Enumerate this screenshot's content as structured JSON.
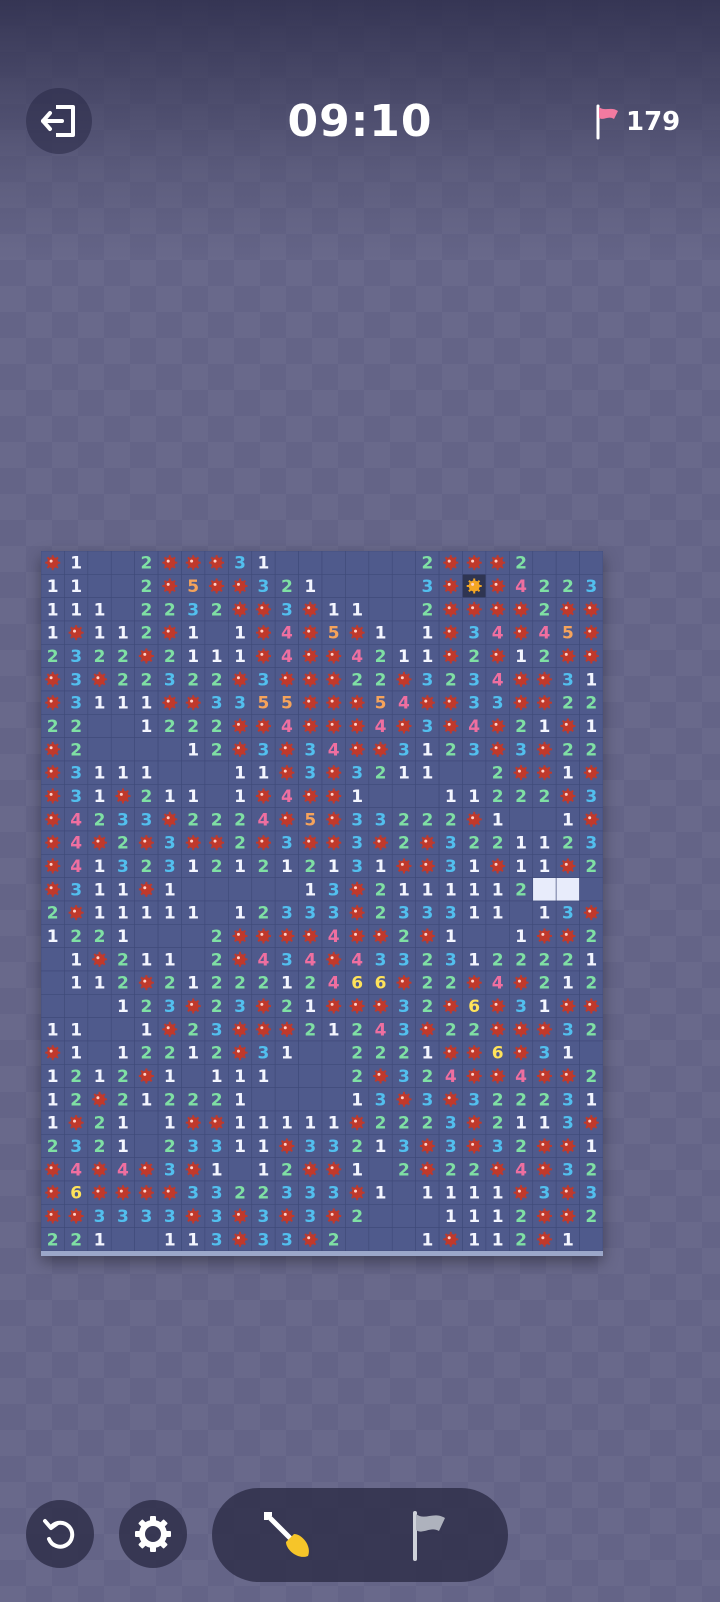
{
  "header": {
    "timer": "09:10",
    "flags_remaining": "179",
    "exit_icon": "exit-icon",
    "flag_icon": "flag-icon"
  },
  "board": {
    "cols": 24,
    "rows": 30,
    "grid": [
      "M1..2MMM31......2MMM2...",
      "11..2M5MM321....3MXM4223",
      "111.2232MM3M11..2MMMM2MM",
      "1M112M1.1M4M5M1.1M34M45M",
      "2322M2111M4MM4211M2M12MM",
      "M3M22322M3MMM22M3234MM31",
      "M3111MM3355MMM54MM33MM2211",
      "22..1222MM4MMM4M3M4M21M1",
      "M2....12M3M34MM3123M3M22",
      "M3111...11M3M3211..2MM1M",
      "M31M211.1M4MM1...11222M3",
      "M4233M2224M5M33222M1..1M",
      "M4M2M3MM2M3MM3M2M3221123",
      "M41323121212131MM31M11M2",
      "M311M1.....13M2111112WW.",
      "2M11111.12333M233311.13M",
      "1221...2MMMM4MM2M1..1MM2",
      ".1M211.2M434M43323122221",
      ".112M2122212466M22M4M212",
      "...123M23M21MMM32M6M31MM",
      "11..1M23MMM21243M22MMM32",
      "M1.12212M31..2221MM6M31.",
      "1212M1.111...2M324MM4MM2",
      "12M212221....13M3M322231",
      "1M21.1MM11111M2223M2113M",
      "2321.23311M33213M3M32MM1",
      "M4M4M3M1.12MM1.2M22M4M32",
      "M6MMMM3322333M1.1111M3M3",
      "MM3333M3M3M3M2...1112MM2",
      "221..113M33M2...1M112M1."
    ],
    "colors": {
      "board": "#4f5a8c",
      "cell_border": "#3f4a79",
      "mine": "#c0392b",
      "n1": "#f4f6ff",
      "n2": "#7fe0a4",
      "n3": "#52bfee",
      "n4": "#ef6fa0",
      "n5": "#f5a35b",
      "n6": "#ffe35a"
    }
  },
  "footer": {
    "restart_icon": "restart-icon",
    "settings_icon": "gear-icon",
    "dig_tool_icon": "shovel-icon",
    "flag_tool_icon": "flag-icon"
  }
}
